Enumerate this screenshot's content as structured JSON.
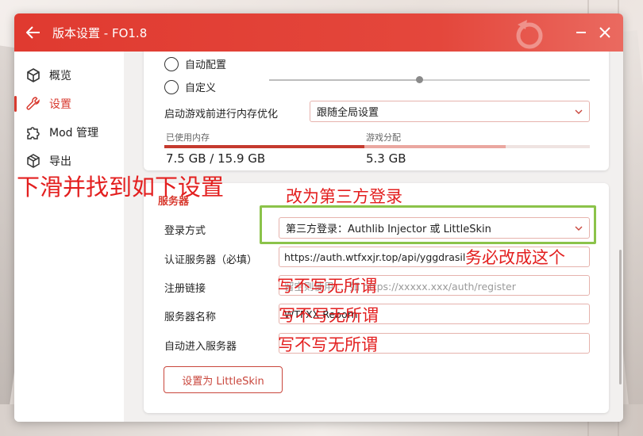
{
  "window": {
    "title": "版本设置 - FO1.8"
  },
  "sidebar": {
    "items": [
      {
        "label": "概览",
        "icon": "cube-icon"
      },
      {
        "label": "设置",
        "icon": "wrench-icon"
      },
      {
        "label": "Mod 管理",
        "icon": "puzzle-icon"
      },
      {
        "label": "导出",
        "icon": "box-icon"
      }
    ]
  },
  "memory": {
    "option_auto": "自动配置",
    "option_custom": "自定义",
    "optimize_label": "启动游戏前进行内存优化",
    "optimize_value": "跟随全局设置",
    "used_label": "已使用内存",
    "used_value": "7.5 GB / 15.9 GB",
    "game_label": "游戏分配",
    "game_value": "5.3 GB"
  },
  "server": {
    "section_title": "服务器",
    "login_label": "登录方式",
    "login_value": "第三方登录：Authlib Injector 或 LittleSkin",
    "auth_label": "认证服务器（必填）",
    "auth_value": "https://auth.wtfxxjr.top/api/yggdrasil",
    "register_label": "注册链接",
    "register_placeholder": "留空则使用 ... 如 https://xxxxx.xxx/auth/register",
    "servername_label": "服务器名称",
    "servername_value": "WTFXX Reborn",
    "autojoin_label": "自动进入服务器",
    "autojoin_value": "",
    "littleskin_button": "设置为 LittleSkin"
  },
  "annotations": {
    "scroll_hint": "下滑并找到如下设置",
    "change_hint": "改为第三方登录",
    "must_hint": "务必改成这个",
    "optional1": "写不写无所谓",
    "optional2": "写不写无所谓",
    "optional3": "写不写无所谓"
  },
  "colors": {
    "accent": "#d83a2f",
    "titlebar": "#e03a30",
    "annotation": "#e31f1f",
    "highlight_box": "#8bc34a"
  }
}
